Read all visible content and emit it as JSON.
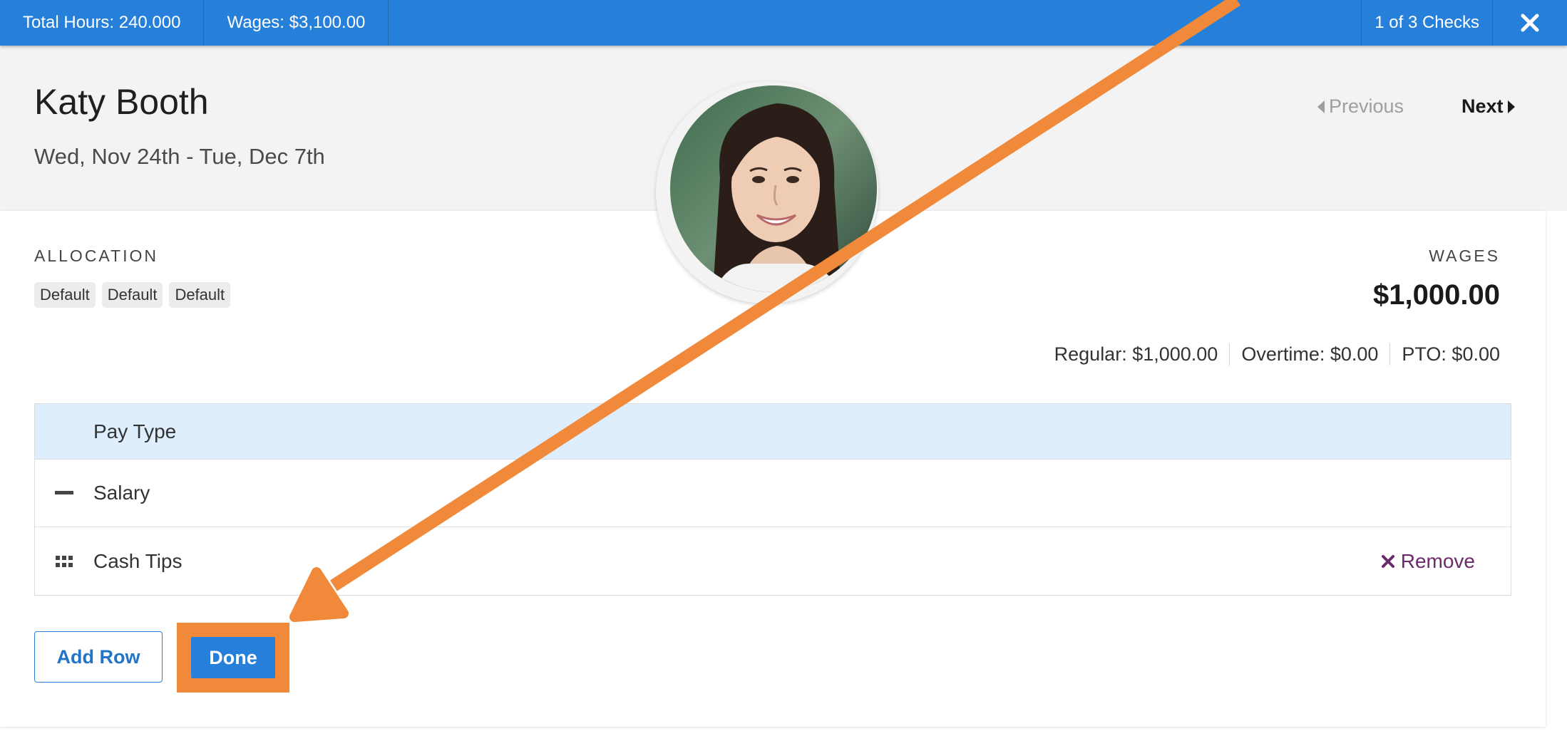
{
  "topbar": {
    "total_hours": "Total Hours: 240.000",
    "wages": "Wages: $3,100.00",
    "checks": "1 of 3 Checks"
  },
  "header": {
    "name": "Katy Booth",
    "dates": "Wed, Nov 24th - Tue, Dec 7th",
    "prev_label": "Previous",
    "next_label": "Next"
  },
  "allocation": {
    "label": "ALLOCATION",
    "tags": [
      "Default",
      "Default",
      "Default"
    ]
  },
  "wages": {
    "label": "WAGES",
    "amount": "$1,000.00",
    "regular": "Regular: $1,000.00",
    "overtime": "Overtime: $0.00",
    "pto": "PTO: $0.00"
  },
  "table": {
    "header": "Pay Type",
    "rows": [
      {
        "label": "Salary",
        "icon": "minus-icon"
      },
      {
        "label": "Cash Tips",
        "icon": "drag-handle-icon",
        "action": "Remove"
      }
    ]
  },
  "buttons": {
    "add_row": "Add Row",
    "done": "Done"
  },
  "colors": {
    "primary": "#2680d9",
    "highlight": "#f08a3a",
    "remove": "#6b2a6b",
    "table_header": "#deeefc"
  }
}
